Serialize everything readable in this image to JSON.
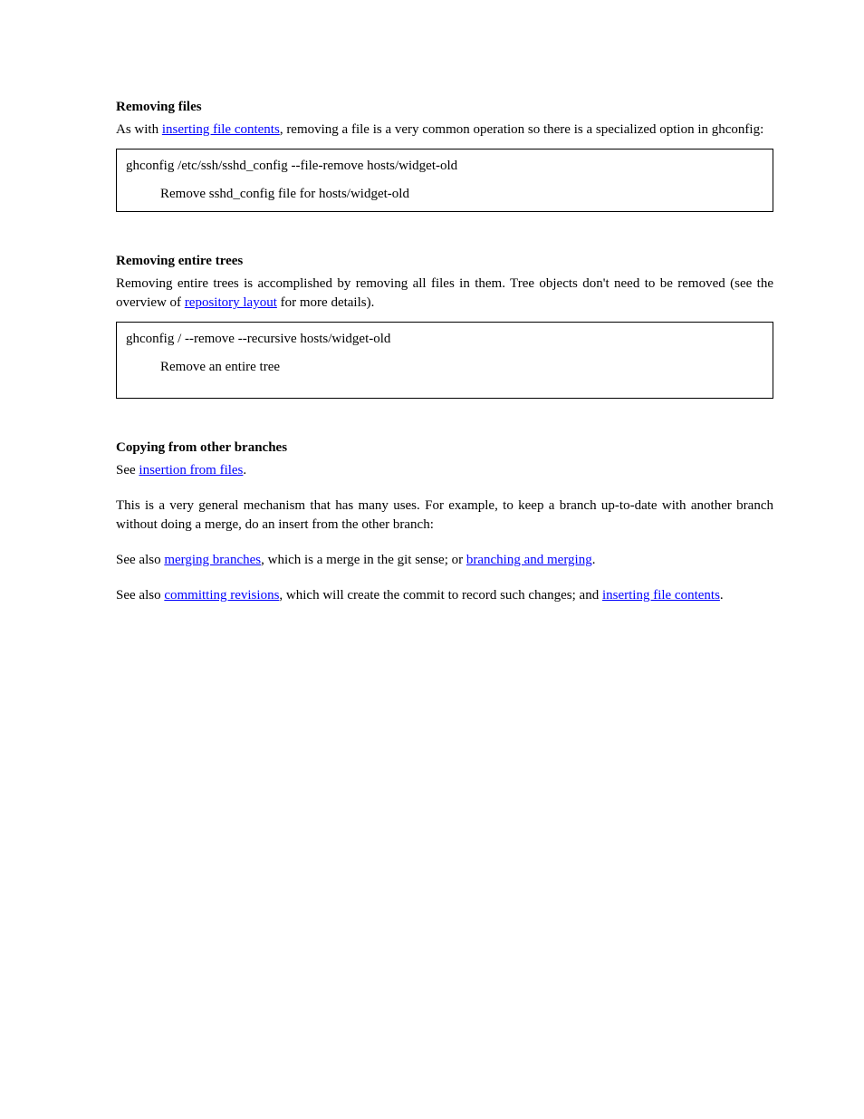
{
  "section1": {
    "heading": "Removing files",
    "p1_before_link": "As with ",
    "p1_link": "inserting file contents",
    "p1_after_link": ", removing a file is a very common operation so there is a specialized option in ghconfig:",
    "box_line": "ghconfig /etc/ssh/sshd_config --file-remove hosts/widget-old",
    "box_indent": "Remove sshd_config file for hosts/widget-old"
  },
  "section2": {
    "heading": "Removing entire trees",
    "p1_before": "Removing entire trees is accomplished by removing all files in them. Tree objects don't need to be removed (see the overview of ",
    "p1_link": "repository layout",
    "p1_after": " for more details).",
    "box_line": "ghconfig / --remove --recursive hosts/widget-old",
    "box_indent": "Remove an entire tree"
  },
  "section3": {
    "heading": "Copying from other branches",
    "p1_before": "See ",
    "p1_link": "insertion from files",
    "p1_after": ".",
    "p2_before": "This is a very general mechanism that has many uses. For example, to keep a branch up-to-date with another branch without doing a merge, do an insert from the other branch:",
    "p3_before": "See also ",
    "p3_link1": "merging branches",
    "p3_mid1": ", which is a merge in the git sense; or ",
    "p3_link2": "branching and merging",
    "p3_mid2": ".",
    "p4_before": "See also ",
    "p4_link1": "committing revisions",
    "p4_mid1": ", which will create the commit to record such changes; and ",
    "p4_link2": "inserting file contents",
    "p4_mid2": "."
  }
}
